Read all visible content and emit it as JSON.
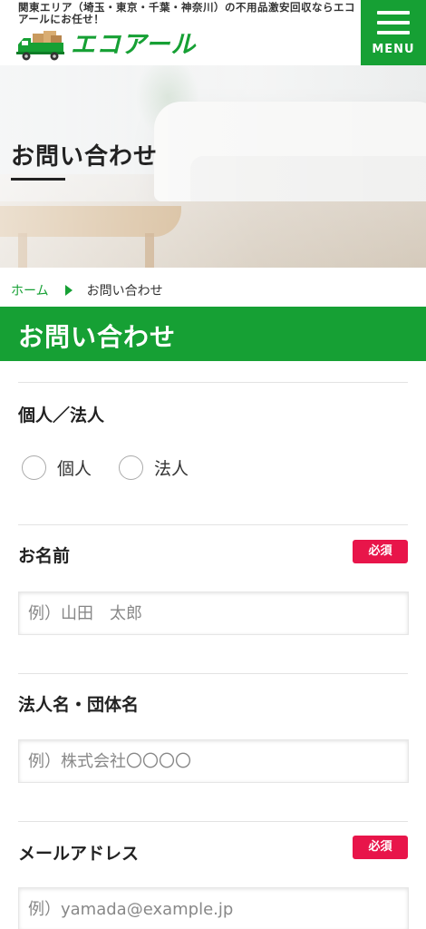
{
  "header": {
    "tagline": "関東エリア（埼玉・東京・千葉・神奈川）の不用品激安回収ならエコアールにお任せ！",
    "logo_text": "エコアール",
    "menu_label": "MENU"
  },
  "hero": {
    "title": "お問い合わせ"
  },
  "breadcrumb": {
    "home": "ホーム",
    "current": "お問い合わせ"
  },
  "section": {
    "title": "お問い合わせ"
  },
  "form": {
    "type": {
      "label": "個人／法人",
      "options": [
        "個人",
        "法人"
      ]
    },
    "name": {
      "label": "お名前",
      "required": "必須",
      "placeholder": "例）山田　太郎"
    },
    "company": {
      "label": "法人名・団体名",
      "placeholder": "例）株式会社〇〇〇〇"
    },
    "email": {
      "label": "メールアドレス",
      "required": "必須",
      "placeholder": "例）yamada@example.jp"
    }
  },
  "colors": {
    "brand_green": "#16a034",
    "required_red": "#e8154a"
  }
}
